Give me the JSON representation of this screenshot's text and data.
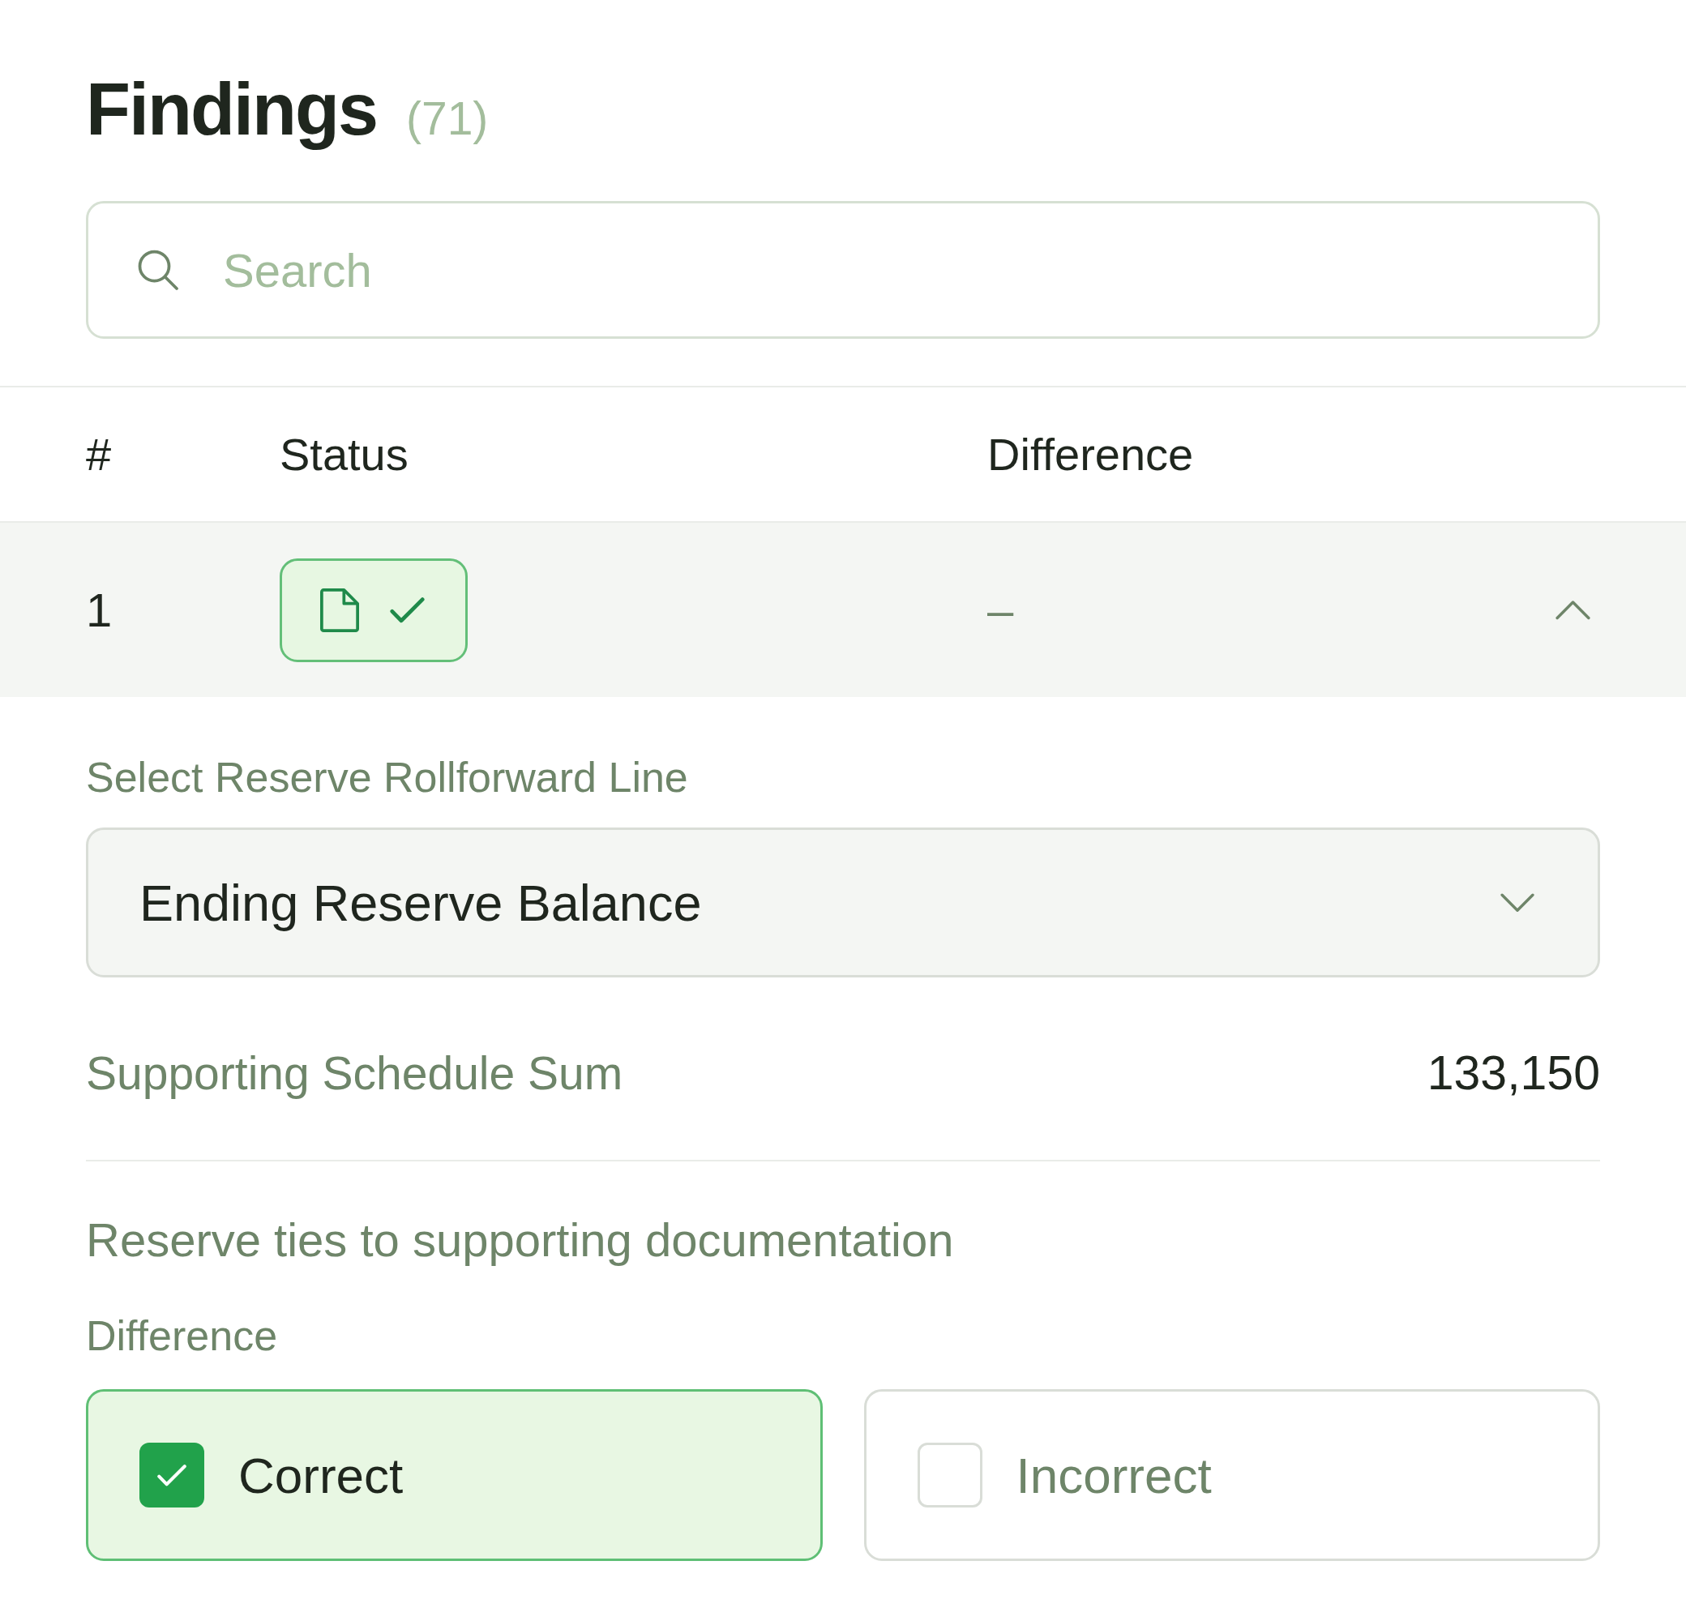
{
  "header": {
    "title": "Findings",
    "count": "(71)"
  },
  "search": {
    "placeholder": "Search"
  },
  "table": {
    "columns": [
      "#",
      "Status",
      "Difference"
    ],
    "rows": [
      {
        "number": "1",
        "verified": true,
        "difference": "–",
        "expanded": true,
        "details": {
          "line_select": {
            "label": "Select Reserve Rollforward Line",
            "value": "Ending Reserve Balance"
          },
          "schedule_sum": {
            "label": "Supporting Schedule Sum",
            "value": "133,150"
          },
          "question": "Reserve ties to supporting documentation",
          "difference": {
            "label": "Difference",
            "options": [
              {
                "label": "Correct",
                "selected": true
              },
              {
                "label": "Incorrect",
                "selected": false
              }
            ]
          }
        }
      }
    ]
  }
}
